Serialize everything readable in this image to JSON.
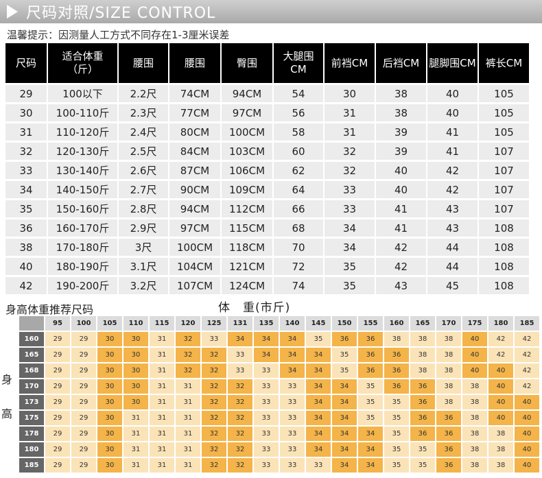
{
  "banner": {
    "title": "尺码对照/SIZE CONTROL"
  },
  "note": "温馨提示：因测量人工方式不同存在1-3厘米误差",
  "size_table": {
    "headers": [
      "尺码",
      "适合体重（斤）",
      "腰围",
      "腰围",
      "臀围",
      "大腿围CM",
      "前裆CM",
      "后裆CM",
      "腿脚围CM",
      "裤长CM"
    ],
    "rows": [
      [
        "29",
        "100以下",
        "2.2尺",
        "74CM",
        "94CM",
        "54",
        "30",
        "38",
        "40",
        "105"
      ],
      [
        "30",
        "100-110斤",
        "2.3尺",
        "77CM",
        "97CM",
        "56",
        "31",
        "38",
        "40",
        "105"
      ],
      [
        "31",
        "110-120斤",
        "2.4尺",
        "80CM",
        "100CM",
        "58",
        "31",
        "39",
        "41",
        "105"
      ],
      [
        "32",
        "120-130斤",
        "2.5尺",
        "84CM",
        "103CM",
        "60",
        "32",
        "39",
        "41",
        "107"
      ],
      [
        "33",
        "130-140斤",
        "2.6尺",
        "87CM",
        "106CM",
        "62",
        "32",
        "40",
        "42",
        "107"
      ],
      [
        "34",
        "140-150斤",
        "2.7尺",
        "90CM",
        "109CM",
        "64",
        "33",
        "40",
        "42",
        "107"
      ],
      [
        "35",
        "150-160斤",
        "2.8尺",
        "94CM",
        "112CM",
        "66",
        "33",
        "41",
        "43",
        "107"
      ],
      [
        "36",
        "160-170斤",
        "2.9尺",
        "97CM",
        "115CM",
        "68",
        "34",
        "41",
        "43",
        "108"
      ],
      [
        "38",
        "170-180斤",
        "3尺",
        "100CM",
        "118CM",
        "70",
        "34",
        "42",
        "44",
        "108"
      ],
      [
        "40",
        "180-190斤",
        "3.1尺",
        "104CM",
        "121CM",
        "72",
        "35",
        "42",
        "44",
        "108"
      ],
      [
        "42",
        "190-200斤",
        "3.2尺",
        "107CM",
        "124CM",
        "74",
        "35",
        "43",
        "45",
        "108"
      ]
    ]
  },
  "recommendation": {
    "title": "身高体重推荐尺码",
    "weight_label": "体　重(市斤)",
    "height_label_1": "身",
    "height_label_2": "高",
    "colors": {
      "light": "#fbe3b8",
      "dark": "#f4b449",
      "header": "#666666"
    },
    "weights": [
      "95",
      "100",
      "105",
      "110",
      "115",
      "120",
      "125",
      "131",
      "135",
      "140",
      "145",
      "150",
      "155",
      "160",
      "165",
      "170",
      "175",
      "180",
      "185"
    ],
    "heights": [
      "160",
      "165",
      "168",
      "170",
      "173",
      "175",
      "178",
      "180",
      "185"
    ],
    "grid": [
      [
        "29",
        "29",
        "30",
        "30",
        "31",
        "32",
        "33",
        "34",
        "34",
        "34",
        "35",
        "36",
        "36",
        "38",
        "38",
        "38",
        "40",
        "42",
        "42"
      ],
      [
        "29",
        "29",
        "30",
        "30",
        "31",
        "32",
        "32",
        "33",
        "34",
        "34",
        "34",
        "35",
        "36",
        "36",
        "38",
        "38",
        "40",
        "42",
        "42"
      ],
      [
        "29",
        "29",
        "30",
        "30",
        "31",
        "32",
        "32",
        "33",
        "33",
        "34",
        "34",
        "35",
        "36",
        "36",
        "38",
        "38",
        "40",
        "40",
        "42"
      ],
      [
        "29",
        "29",
        "30",
        "30",
        "31",
        "31",
        "32",
        "32",
        "33",
        "33",
        "34",
        "34",
        "35",
        "36",
        "36",
        "38",
        "38",
        "40",
        "42"
      ],
      [
        "29",
        "29",
        "30",
        "30",
        "31",
        "31",
        "32",
        "32",
        "33",
        "33",
        "34",
        "34",
        "35",
        "35",
        "36",
        "38",
        "38",
        "40",
        "40"
      ],
      [
        "29",
        "29",
        "30",
        "31",
        "31",
        "31",
        "32",
        "32",
        "33",
        "33",
        "34",
        "34",
        "35",
        "35",
        "36",
        "36",
        "38",
        "40",
        "40"
      ],
      [
        "29",
        "29",
        "30",
        "31",
        "31",
        "31",
        "32",
        "32",
        "33",
        "33",
        "34",
        "34",
        "34",
        "35",
        "36",
        "36",
        "38",
        "38",
        "40"
      ],
      [
        "29",
        "29",
        "30",
        "31",
        "31",
        "31",
        "32",
        "32",
        "33",
        "33",
        "34",
        "34",
        "34",
        "35",
        "35",
        "36",
        "38",
        "38",
        "40"
      ],
      [
        "29",
        "29",
        "30",
        "31",
        "31",
        "31",
        "32",
        "32",
        "33",
        "33",
        "33",
        "34",
        "34",
        "35",
        "35",
        "36",
        "38",
        "38",
        "40"
      ]
    ],
    "highlight_sizes": [
      "30",
      "32",
      "34",
      "36",
      "40"
    ]
  }
}
